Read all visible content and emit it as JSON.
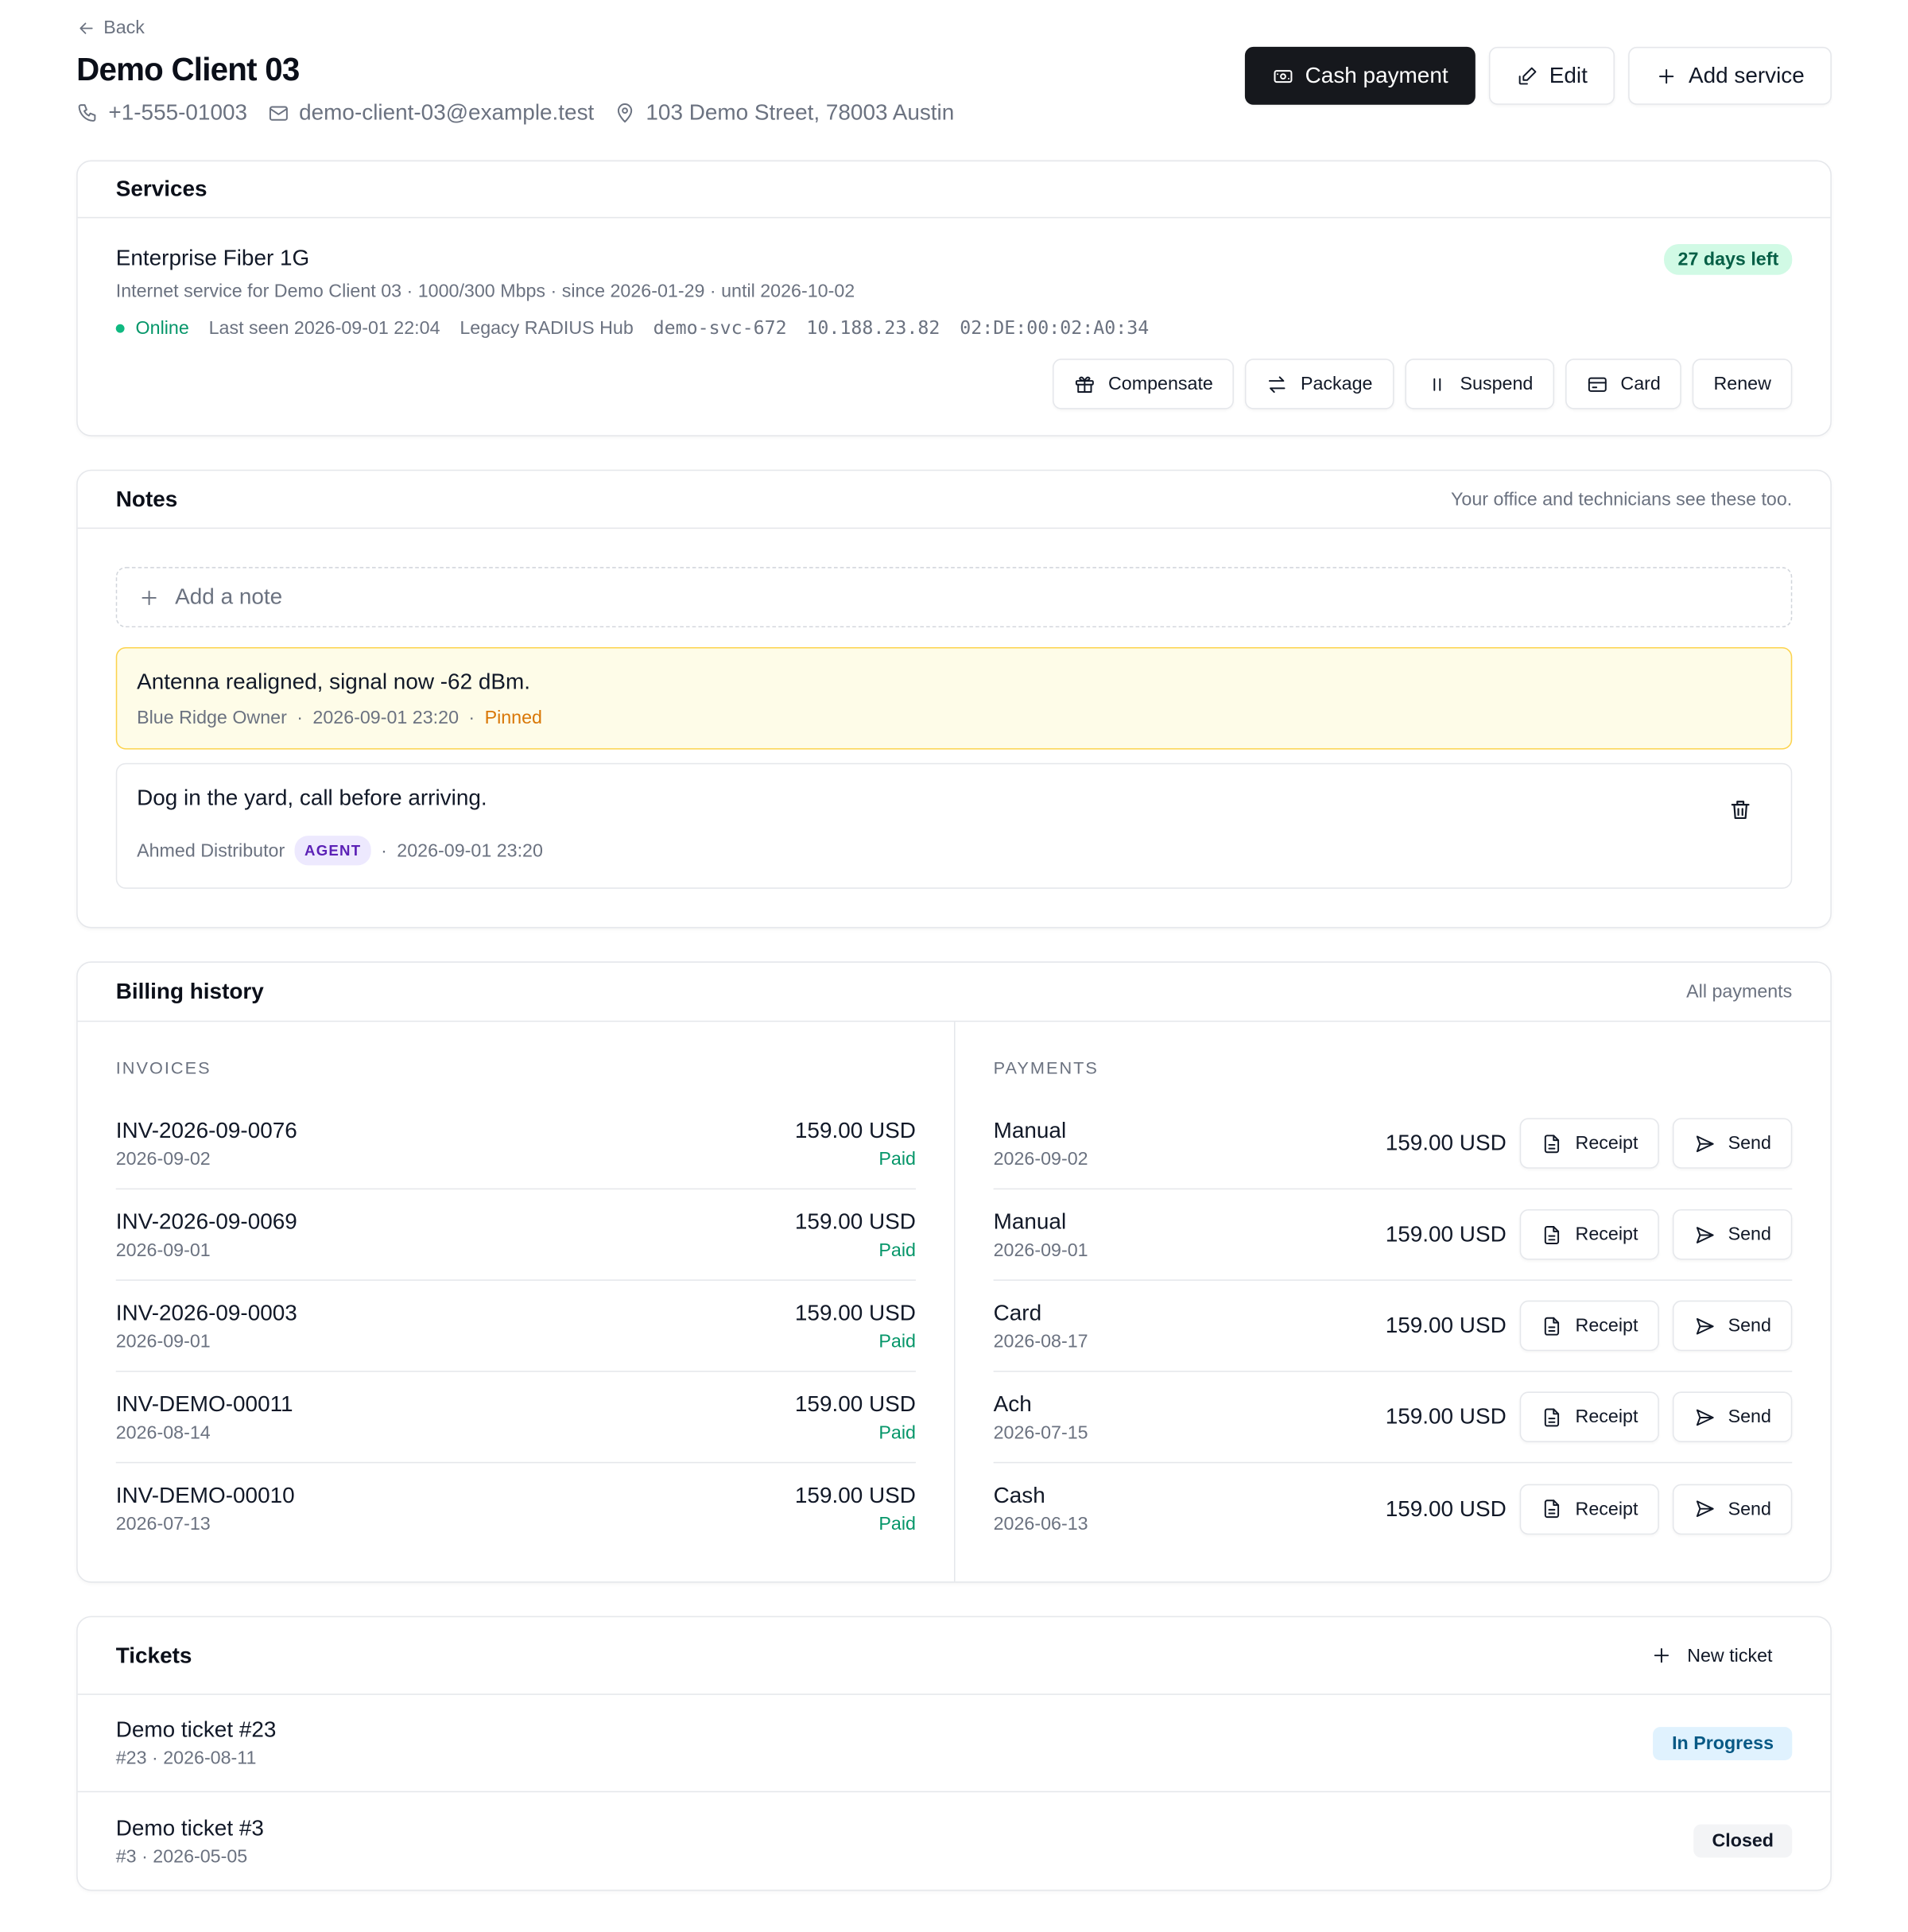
{
  "header": {
    "back_label": "Back",
    "title": "Demo Client 03",
    "phone": "+1-555-01003",
    "email": "demo-client-03@example.test",
    "address": "103 Demo Street, 78003 Austin",
    "actions": {
      "cash_payment": "Cash payment",
      "edit": "Edit",
      "add_service": "Add service"
    }
  },
  "services": {
    "title": "Services",
    "item": {
      "name": "Enterprise Fiber 1G",
      "description": "Internet service for Demo Client 03 · 1000/300 Mbps · since 2026-01-29 · until 2026-10-02",
      "days_left": "27 days left",
      "status": "Online",
      "last_seen": "Last seen 2026-09-01 22:04",
      "hub": "Legacy RADIUS Hub",
      "username": "demo-svc-672",
      "ip": "10.188.23.82",
      "mac": "02:DE:00:02:A0:34",
      "actions": {
        "compensate": "Compensate",
        "package": "Package",
        "suspend": "Suspend",
        "card": "Card",
        "renew": "Renew"
      }
    }
  },
  "notes": {
    "title": "Notes",
    "subtitle": "Your office and technicians see these too.",
    "add_placeholder": "Add a note",
    "items": [
      {
        "text": "Antenna realigned, signal now -62 dBm.",
        "author": "Blue Ridge Owner",
        "time": "2026-09-01 23:20",
        "flag": "Pinned"
      },
      {
        "text": "Dog in the yard, call before arriving.",
        "author": "Ahmed Distributor",
        "role": "AGENT",
        "time": "2026-09-01 23:20"
      }
    ]
  },
  "billing": {
    "title": "Billing history",
    "all_link": "All payments",
    "invoices_label": "INVOICES",
    "payments_label": "PAYMENTS",
    "receipt_label": "Receipt",
    "send_label": "Send",
    "invoices": [
      {
        "number": "INV-2026-09-0076",
        "date": "2026-09-02",
        "amount": "159.00 USD",
        "status": "Paid"
      },
      {
        "number": "INV-2026-09-0069",
        "date": "2026-09-01",
        "amount": "159.00 USD",
        "status": "Paid"
      },
      {
        "number": "INV-2026-09-0003",
        "date": "2026-09-01",
        "amount": "159.00 USD",
        "status": "Paid"
      },
      {
        "number": "INV-DEMO-00011",
        "date": "2026-08-14",
        "amount": "159.00 USD",
        "status": "Paid"
      },
      {
        "number": "INV-DEMO-00010",
        "date": "2026-07-13",
        "amount": "159.00 USD",
        "status": "Paid"
      }
    ],
    "payments": [
      {
        "method": "Manual",
        "date": "2026-09-02",
        "amount": "159.00 USD"
      },
      {
        "method": "Manual",
        "date": "2026-09-01",
        "amount": "159.00 USD"
      },
      {
        "method": "Card",
        "date": "2026-08-17",
        "amount": "159.00 USD"
      },
      {
        "method": "Ach",
        "date": "2026-07-15",
        "amount": "159.00 USD"
      },
      {
        "method": "Cash",
        "date": "2026-06-13",
        "amount": "159.00 USD"
      }
    ]
  },
  "tickets": {
    "title": "Tickets",
    "new_label": "New ticket",
    "items": [
      {
        "title": "Demo ticket #23",
        "meta": "#23 · 2026-08-11",
        "status": "In Progress"
      },
      {
        "title": "Demo ticket #3",
        "meta": "#3 · 2026-05-05",
        "status": "Closed"
      }
    ]
  },
  "colors": {
    "accent_dark": "#16181d",
    "success": "#059669",
    "pinned": "#d97706",
    "agent": "#5b21b6",
    "in_progress": "#075985"
  }
}
